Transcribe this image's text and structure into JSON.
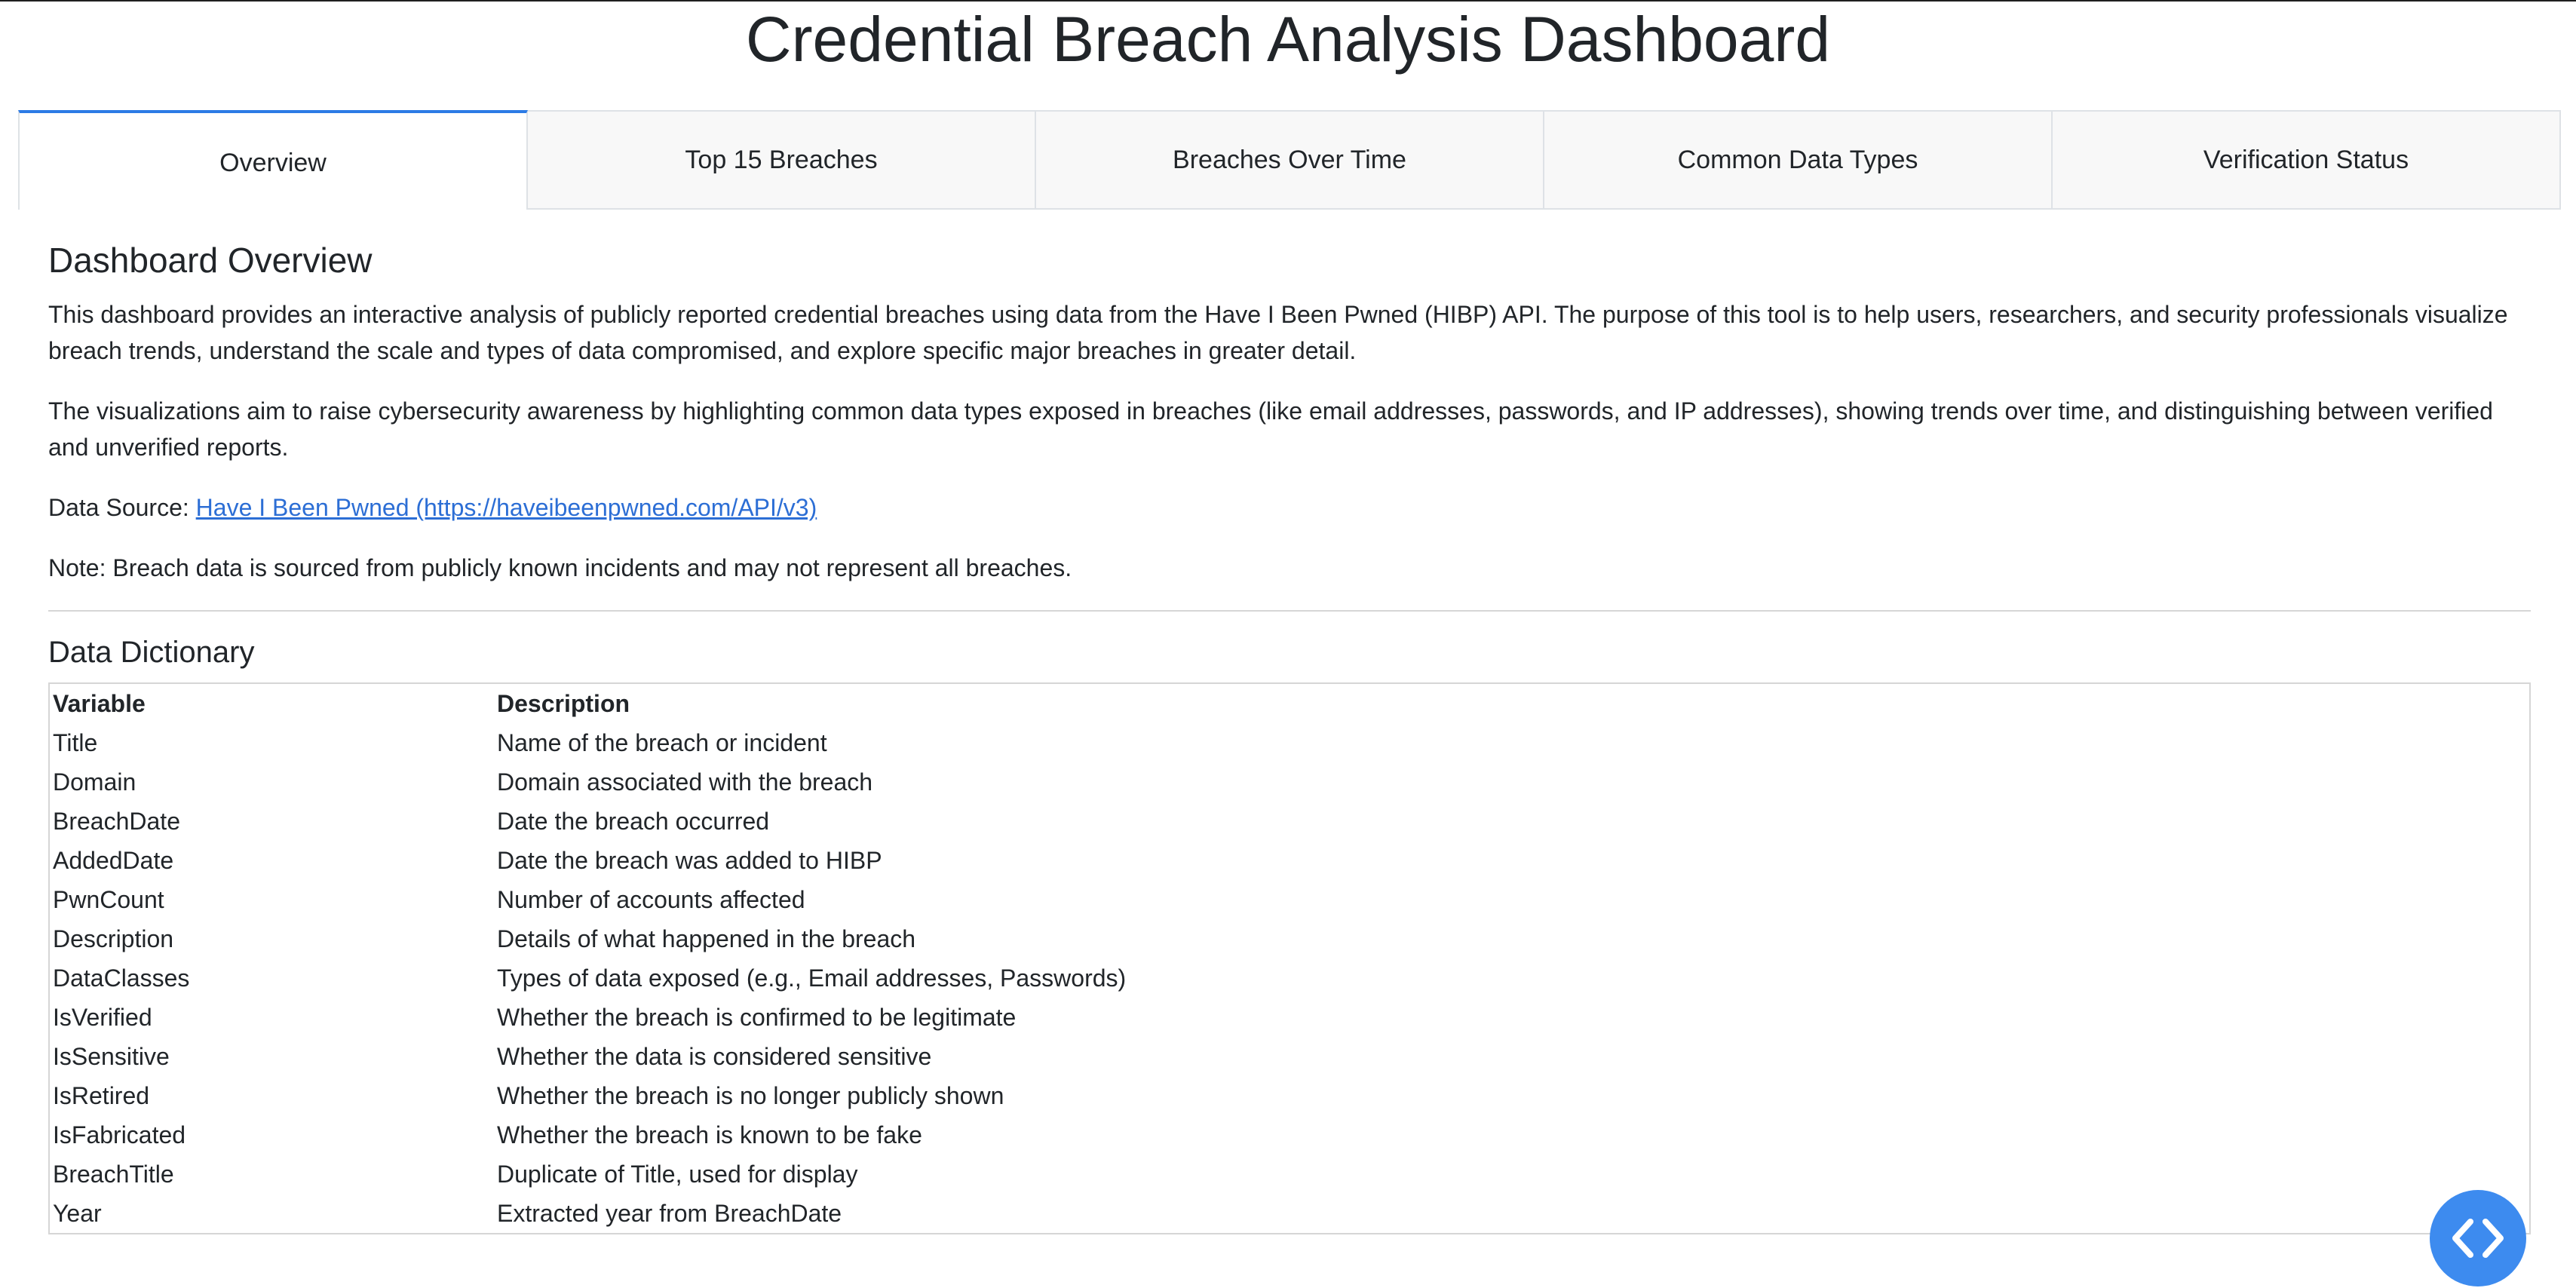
{
  "header": {
    "title": "Credential Breach Analysis Dashboard"
  },
  "tabs": [
    {
      "label": "Overview",
      "active": true
    },
    {
      "label": "Top 15 Breaches",
      "active": false
    },
    {
      "label": "Breaches Over Time",
      "active": false
    },
    {
      "label": "Common Data Types",
      "active": false
    },
    {
      "label": "Verification Status",
      "active": false
    }
  ],
  "overview": {
    "heading": "Dashboard Overview",
    "paragraph1": "This dashboard provides an interactive analysis of publicly reported credential breaches using data from the Have I Been Pwned (HIBP) API. The purpose of this tool is to help users, researchers, and security professionals visualize breach trends, understand the scale and types of data compromised, and explore specific major breaches in greater detail.",
    "paragraph2": "The visualizations aim to raise cybersecurity awareness by highlighting common data types exposed in breaches (like email addresses, passwords, and IP addresses), showing trends over time, and distinguishing between verified and unverified reports.",
    "source_label": "Data Source: ",
    "source_link_text": "Have I Been Pwned (https://haveibeenpwned.com/API/v3)",
    "note": "Note: Breach data is sourced from publicly known incidents and may not represent all breaches."
  },
  "dictionary": {
    "heading": "Data Dictionary",
    "columns": [
      "Variable",
      "Description"
    ],
    "rows": [
      [
        "Title",
        "Name of the breach or incident"
      ],
      [
        "Domain",
        "Domain associated with the breach"
      ],
      [
        "BreachDate",
        "Date the breach occurred"
      ],
      [
        "AddedDate",
        "Date the breach was added to HIBP"
      ],
      [
        "PwnCount",
        "Number of accounts affected"
      ],
      [
        "Description",
        "Details of what happened in the breach"
      ],
      [
        "DataClasses",
        "Types of data exposed (e.g., Email addresses, Passwords)"
      ],
      [
        "IsVerified",
        "Whether the breach is confirmed to be legitimate"
      ],
      [
        "IsSensitive",
        "Whether the data is considered sensitive"
      ],
      [
        "IsRetired",
        "Whether the breach is no longer publicly shown"
      ],
      [
        "IsFabricated",
        "Whether the breach is known to be fake"
      ],
      [
        "BreachTitle",
        "Duplicate of Title, used for display"
      ],
      [
        "Year",
        "Extracted year from BreachDate"
      ]
    ]
  },
  "fab": {
    "icon": "code-icon"
  },
  "colors": {
    "accent": "#2c7be5",
    "link": "#2c6ed5",
    "fab": "#3d8bef"
  }
}
